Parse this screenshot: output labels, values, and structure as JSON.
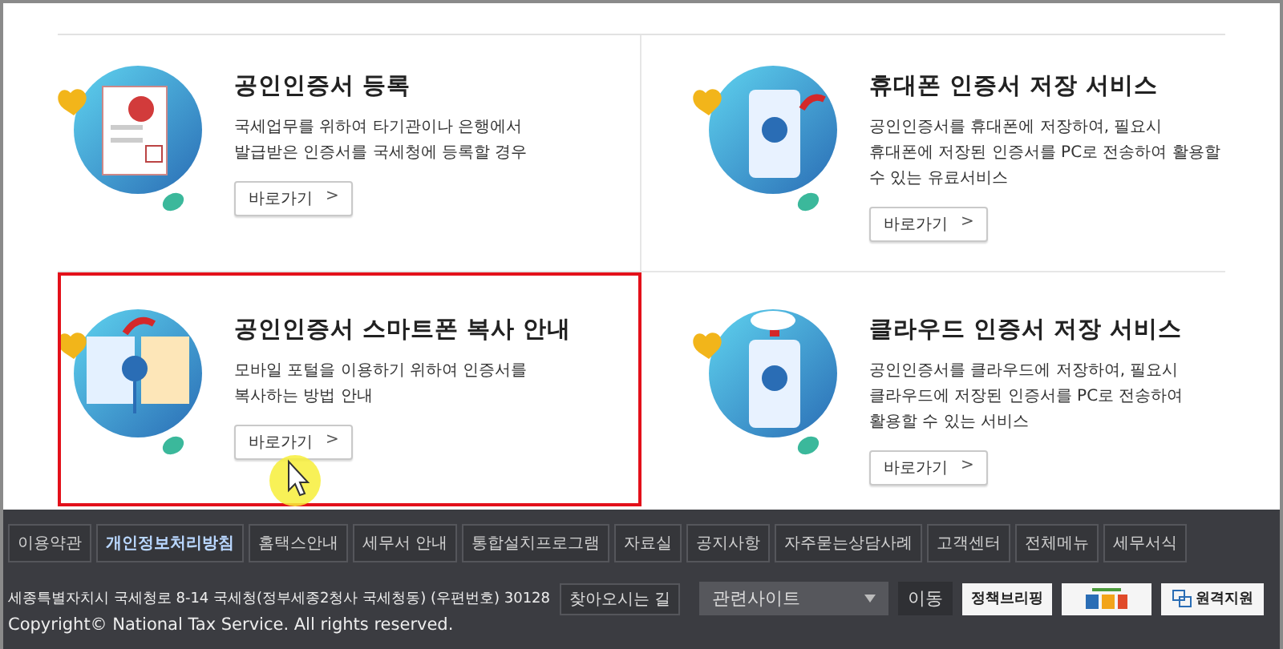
{
  "cards": [
    {
      "kind": "certificate",
      "title": "공인인증서 등록",
      "description": "국세업무를 위하여 타기관이나 은행에서 발급받은 인증서를 국세청에 등록할 경우",
      "button": "바로가기",
      "arrow": ">",
      "highlighted": false
    },
    {
      "kind": "phone",
      "title": "휴대폰 인증서 저장 서비스",
      "description": "공인인증서를 휴대폰에 저장하여, 필요시 휴대폰에 저장된 인증서를 PC로 전송하여 활용할 수 있는 유료서비스",
      "button": "바로가기",
      "arrow": ">",
      "highlighted": false
    },
    {
      "kind": "copy",
      "title": "공인인증서 스마트폰 복사 안내",
      "description": "모바일 포털을 이용하기 위하여 인증서를 복사하는 방법 안내",
      "button": "바로가기",
      "arrow": ">",
      "highlighted": true
    },
    {
      "kind": "cloud",
      "title": "클라우드 인증서 저장 서비스",
      "description": "공인인증서를 클라우드에 저장하여, 필요시 클라우드에 저장된 인증서를 PC로 전송하여 활용할 수 있는 서비스",
      "button": "바로가기",
      "arrow": ">",
      "highlighted": false
    }
  ],
  "footer_nav": [
    {
      "label": "이용약관",
      "selected": false
    },
    {
      "label": "개인정보처리방침",
      "selected": true
    },
    {
      "label": "홈택스안내",
      "selected": false
    },
    {
      "label": "세무서 안내",
      "selected": false
    },
    {
      "label": "통합설치프로그램",
      "selected": false
    },
    {
      "label": "자료실",
      "selected": false
    },
    {
      "label": "공지사항",
      "selected": false
    },
    {
      "label": "자주묻는상담사례",
      "selected": false
    },
    {
      "label": "고객센터",
      "selected": false
    },
    {
      "label": "전체메뉴",
      "selected": false
    },
    {
      "label": "세무서식",
      "selected": false
    }
  ],
  "address": "세종특별자치시 국세청로 8-14 국세청(정부세종2청사 국세청동) (우편번호) 30128",
  "directions_button": "찾아오시는 길",
  "related_sites": {
    "value": "관련사이트"
  },
  "go_button": "이동",
  "banners": [
    {
      "kind": "policy",
      "label": "정책브리핑"
    },
    {
      "kind": "logo"
    },
    {
      "kind": "remote",
      "label": "원격지원"
    }
  ],
  "copyright": "Copyright© National Tax Service. All rights reserved."
}
